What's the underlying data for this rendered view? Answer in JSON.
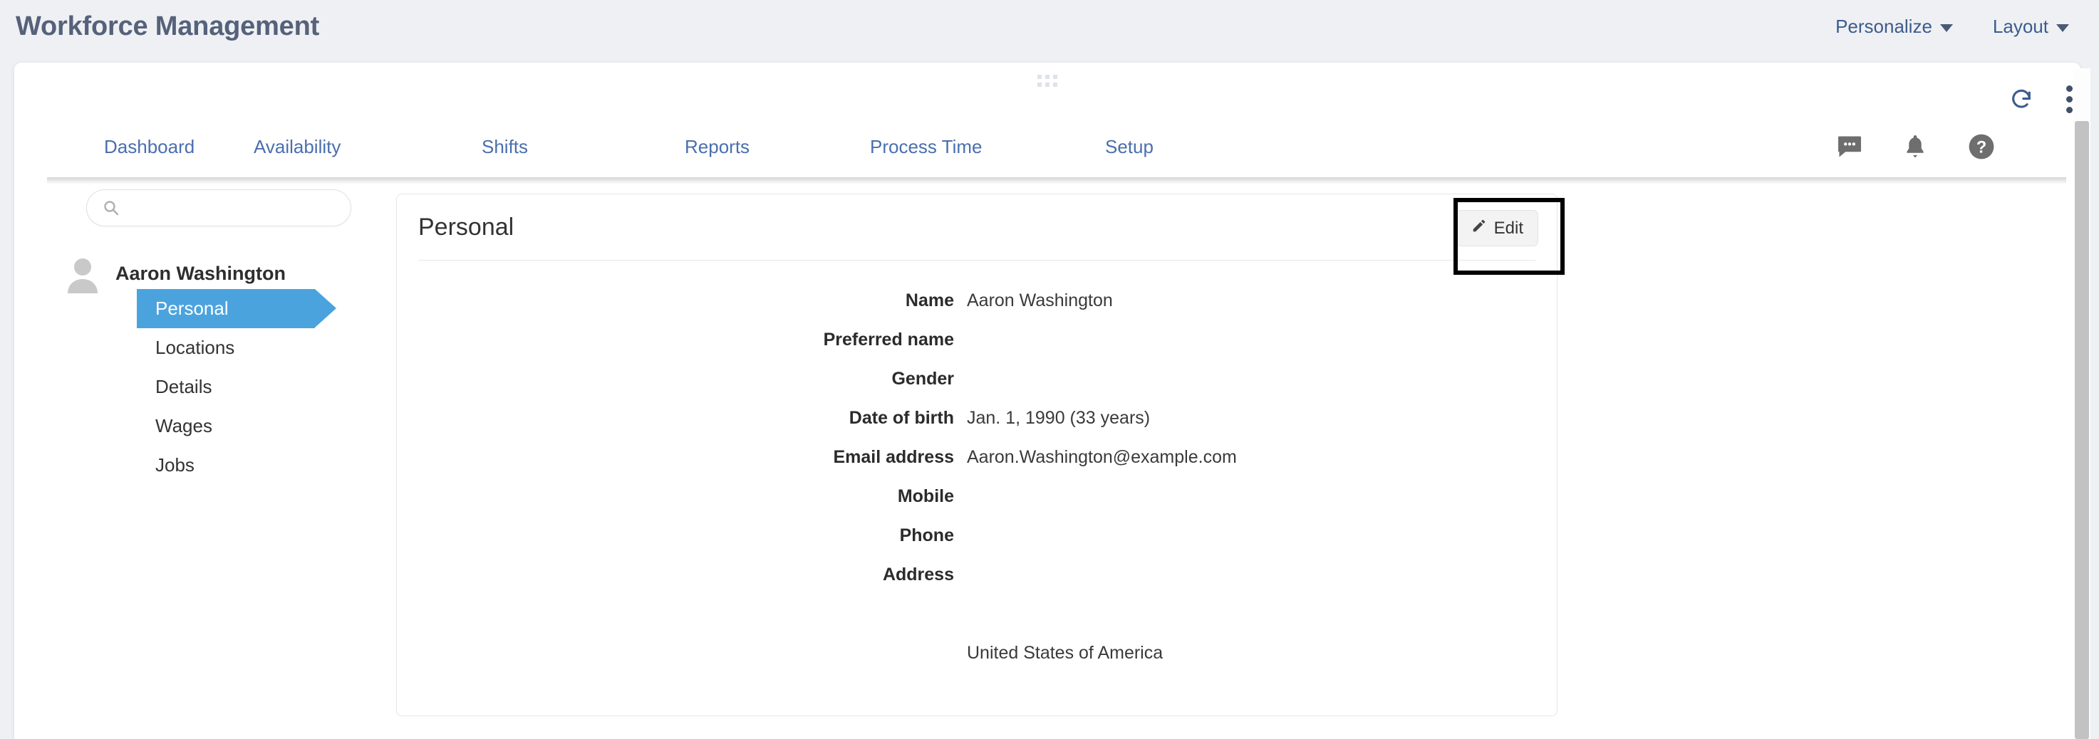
{
  "app": {
    "title": "Workforce Management",
    "menus": [
      {
        "label": "Personalize",
        "icon": "chevron-down-icon"
      },
      {
        "label": "Layout",
        "icon": "chevron-down-icon"
      }
    ]
  },
  "card_tools": {
    "refresh_icon": "refresh-icon",
    "more_icon": "kebab-menu-icon",
    "drag_handle_icon": "drag-handle-icon"
  },
  "nav": {
    "tabs": [
      {
        "label": "Dashboard"
      },
      {
        "label": "Availability"
      },
      {
        "label": "Shifts"
      },
      {
        "label": "Reports"
      },
      {
        "label": "Process Time"
      },
      {
        "label": "Setup"
      }
    ],
    "icons": [
      {
        "name": "chat-icon"
      },
      {
        "name": "bell-icon"
      },
      {
        "name": "help-icon"
      }
    ]
  },
  "sidebar": {
    "search": {
      "value": "",
      "placeholder": "",
      "icon": "search-icon"
    },
    "person": {
      "name": "Aaron Washington",
      "avatar_icon": "avatar-icon"
    },
    "items": [
      {
        "label": "Personal",
        "active": true
      },
      {
        "label": "Locations",
        "active": false
      },
      {
        "label": "Details",
        "active": false
      },
      {
        "label": "Wages",
        "active": false
      },
      {
        "label": "Jobs",
        "active": false
      }
    ]
  },
  "panel": {
    "title": "Personal",
    "edit_button": {
      "label": "Edit",
      "icon": "pencil-icon"
    },
    "fields": [
      {
        "label": "Name",
        "value": "Aaron Washington"
      },
      {
        "label": "Preferred name",
        "value": ""
      },
      {
        "label": "Gender",
        "value": ""
      },
      {
        "label": "Date of birth",
        "value": "Jan. 1, 1990 (33 years)"
      },
      {
        "label": "Email address",
        "value": "Aaron.Washington@example.com"
      },
      {
        "label": "Mobile",
        "value": ""
      },
      {
        "label": "Phone",
        "value": ""
      },
      {
        "label": "Address",
        "value": ""
      }
    ],
    "address_country": "United States of America"
  },
  "colors": {
    "page_background": "#eef0f4",
    "title_text": "#56617a",
    "nav_link": "#4a6fae",
    "active_item": "#4ba3dd",
    "highlight_box": "#000000"
  }
}
